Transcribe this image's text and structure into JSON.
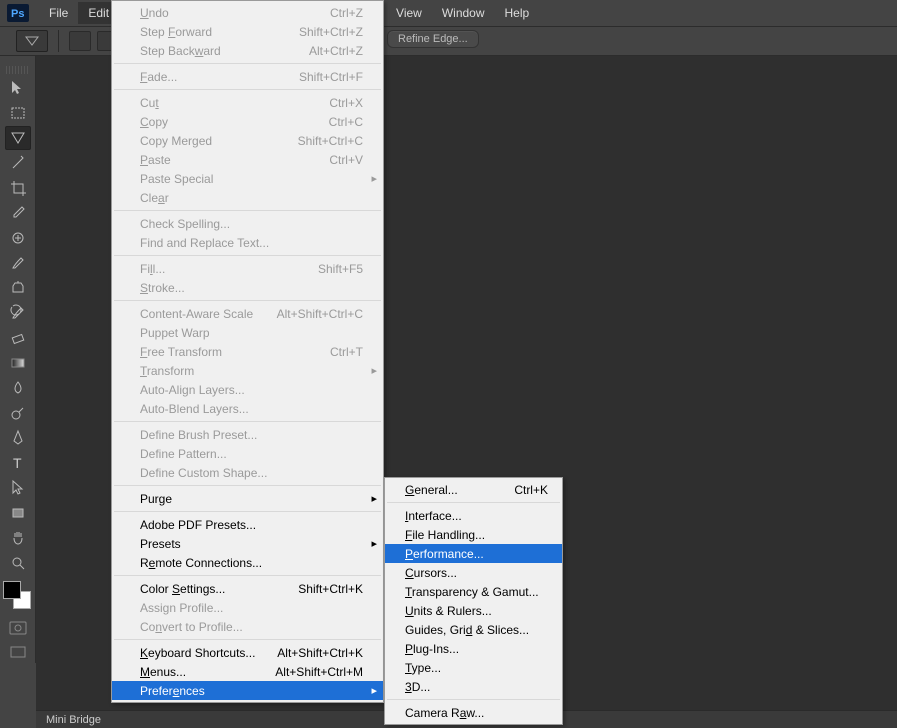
{
  "menubar": {
    "items": [
      "File",
      "Edit",
      "View",
      "Window",
      "Help"
    ]
  },
  "optionsbar": {
    "refine_label": "Refine Edge..."
  },
  "statusbar": {
    "label": "Mini Bridge"
  },
  "edit_menu": {
    "groups": [
      [
        {
          "label": "Undo",
          "u": 0,
          "shortcut": "Ctrl+Z",
          "disabled": true
        },
        {
          "label": "Step Forward",
          "u": 5,
          "shortcut": "Shift+Ctrl+Z",
          "disabled": true
        },
        {
          "label": "Step Backward",
          "u": 9,
          "shortcut": "Alt+Ctrl+Z",
          "disabled": true
        }
      ],
      [
        {
          "label": "Fade...",
          "u": 0,
          "shortcut": "Shift+Ctrl+F",
          "disabled": true
        }
      ],
      [
        {
          "label": "Cut",
          "u": 2,
          "shortcut": "Ctrl+X",
          "disabled": true
        },
        {
          "label": "Copy",
          "u": 0,
          "shortcut": "Ctrl+C",
          "disabled": true
        },
        {
          "label": "Copy Merged",
          "u": -1,
          "shortcut": "Shift+Ctrl+C",
          "disabled": true
        },
        {
          "label": "Paste",
          "u": 0,
          "shortcut": "Ctrl+V",
          "disabled": true
        },
        {
          "label": "Paste Special",
          "u": -1,
          "shortcut": "",
          "disabled": true,
          "arrow": true
        },
        {
          "label": "Clear",
          "u": 3,
          "shortcut": "",
          "disabled": true
        }
      ],
      [
        {
          "label": "Check Spelling...",
          "u": -1,
          "shortcut": "",
          "disabled": true
        },
        {
          "label": "Find and Replace Text...",
          "u": -1,
          "shortcut": "",
          "disabled": true
        }
      ],
      [
        {
          "label": "Fill...",
          "u": 2,
          "shortcut": "Shift+F5",
          "disabled": true
        },
        {
          "label": "Stroke...",
          "u": 0,
          "shortcut": "",
          "disabled": true
        }
      ],
      [
        {
          "label": "Content-Aware Scale",
          "u": -1,
          "shortcut": "Alt+Shift+Ctrl+C",
          "disabled": true
        },
        {
          "label": "Puppet Warp",
          "u": -1,
          "shortcut": "",
          "disabled": true
        },
        {
          "label": "Free Transform",
          "u": 0,
          "shortcut": "Ctrl+T",
          "disabled": true
        },
        {
          "label": "Transform",
          "u": 0,
          "shortcut": "",
          "disabled": true,
          "arrow": true
        },
        {
          "label": "Auto-Align Layers...",
          "u": -1,
          "shortcut": "",
          "disabled": true
        },
        {
          "label": "Auto-Blend Layers...",
          "u": -1,
          "shortcut": "",
          "disabled": true
        }
      ],
      [
        {
          "label": "Define Brush Preset...",
          "u": -1,
          "shortcut": "",
          "disabled": true
        },
        {
          "label": "Define Pattern...",
          "u": -1,
          "shortcut": "",
          "disabled": true
        },
        {
          "label": "Define Custom Shape...",
          "u": -1,
          "shortcut": "",
          "disabled": true
        }
      ],
      [
        {
          "label": "Purge",
          "u": -1,
          "shortcut": "",
          "disabled": false,
          "arrow": true
        }
      ],
      [
        {
          "label": "Adobe PDF Presets...",
          "u": -1,
          "shortcut": "",
          "disabled": false
        },
        {
          "label": "Presets",
          "u": -1,
          "shortcut": "",
          "disabled": false,
          "arrow": true
        },
        {
          "label": "Remote Connections...",
          "u": 1,
          "shortcut": "",
          "disabled": false
        }
      ],
      [
        {
          "label": "Color Settings...",
          "u": 6,
          "shortcut": "Shift+Ctrl+K",
          "disabled": false
        },
        {
          "label": "Assign Profile...",
          "u": -1,
          "shortcut": "",
          "disabled": true
        },
        {
          "label": "Convert to Profile...",
          "u": 2,
          "shortcut": "",
          "disabled": true
        }
      ],
      [
        {
          "label": "Keyboard Shortcuts...",
          "u": 0,
          "shortcut": "Alt+Shift+Ctrl+K",
          "disabled": false
        },
        {
          "label": "Menus...",
          "u": 0,
          "shortcut": "Alt+Shift+Ctrl+M",
          "disabled": false
        },
        {
          "label": "Preferences",
          "u": 6,
          "shortcut": "",
          "disabled": false,
          "arrow": true,
          "highlight": true
        }
      ]
    ],
    "open_item_index": "10.2"
  },
  "prefs_submenu": {
    "groups": [
      [
        {
          "label": "General...",
          "u": 0,
          "shortcut": "Ctrl+K"
        }
      ],
      [
        {
          "label": "Interface...",
          "u": 0
        },
        {
          "label": "File Handling...",
          "u": 0
        },
        {
          "label": "Performance...",
          "u": 0,
          "highlight": true
        },
        {
          "label": "Cursors...",
          "u": 0
        },
        {
          "label": "Transparency & Gamut...",
          "u": 0
        },
        {
          "label": "Units & Rulers...",
          "u": 0
        },
        {
          "label": "Guides, Grid & Slices...",
          "u": 11
        },
        {
          "label": "Plug-Ins...",
          "u": 0
        },
        {
          "label": "Type...",
          "u": 0
        },
        {
          "label": "3D...",
          "u": 0
        }
      ],
      [
        {
          "label": "Camera Raw...",
          "u": 8
        }
      ]
    ]
  },
  "tools": [
    "move",
    "rect-marquee",
    "lasso",
    "magic-wand",
    "crop",
    "eyedropper",
    "spot-heal",
    "brush",
    "clone",
    "history-brush",
    "eraser",
    "gradient",
    "blur",
    "dodge",
    "pen",
    "type",
    "path-select",
    "rectangle",
    "hand",
    "zoom"
  ]
}
